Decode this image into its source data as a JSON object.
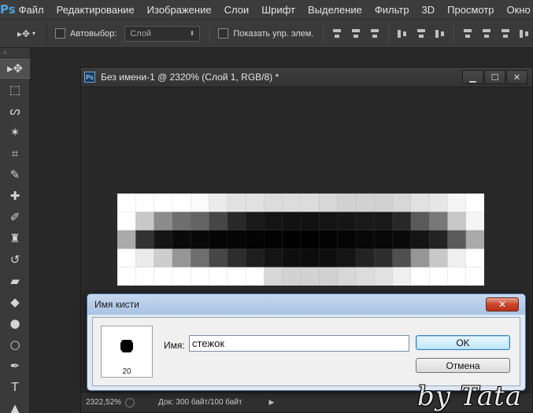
{
  "menubar": {
    "logo": "Ps",
    "items": [
      "Файл",
      "Редактирование",
      "Изображение",
      "Слои",
      "Шрифт",
      "Выделение",
      "Фильтр",
      "3D",
      "Просмотр",
      "Окно"
    ]
  },
  "options": {
    "tool_preset_icon": "move-tool-icon",
    "autoselect_label": "Автовыбор:",
    "autoselect_value": "Слой",
    "show_transform_label": "Показать упр. элем."
  },
  "tools": {
    "header": "»",
    "items": [
      {
        "name": "move-tool-icon",
        "glyph": "▸✥",
        "active": true
      },
      {
        "name": "marquee-tool-icon",
        "glyph": "⬚"
      },
      {
        "name": "lasso-tool-icon",
        "glyph": "ᔕ"
      },
      {
        "name": "magic-wand-tool-icon",
        "glyph": "✶"
      },
      {
        "name": "crop-tool-icon",
        "glyph": "⌗"
      },
      {
        "name": "eyedropper-tool-icon",
        "glyph": "✎"
      },
      {
        "name": "healing-brush-tool-icon",
        "glyph": "✚"
      },
      {
        "name": "brush-tool-icon",
        "glyph": "✐"
      },
      {
        "name": "clone-stamp-tool-icon",
        "glyph": "♜"
      },
      {
        "name": "history-brush-tool-icon",
        "glyph": "↺"
      },
      {
        "name": "eraser-tool-icon",
        "glyph": "▰"
      },
      {
        "name": "paint-bucket-tool-icon",
        "glyph": "◆"
      },
      {
        "name": "blur-tool-icon",
        "glyph": "●"
      },
      {
        "name": "dodge-tool-icon",
        "glyph": "○"
      },
      {
        "name": "pen-tool-icon",
        "glyph": "✒"
      },
      {
        "name": "type-tool-icon",
        "glyph": "T"
      },
      {
        "name": "path-selection-tool-icon",
        "glyph": "▲"
      }
    ]
  },
  "document": {
    "icon": "Ps",
    "title": "Без имени-1 @ 2320% (Слой 1, RGB/8) *",
    "zoom": "2322,52%",
    "doc_info": "Док: 300 байт/100 байт",
    "window_buttons": {
      "minimize": "▁",
      "maximize": "☐",
      "close": "✕"
    },
    "pixels": [
      [
        255,
        255,
        255,
        255,
        250,
        235,
        225,
        225,
        220,
        220,
        220,
        215,
        210,
        210,
        210,
        215,
        225,
        230,
        245,
        255
      ],
      [
        255,
        200,
        140,
        110,
        100,
        70,
        40,
        25,
        20,
        18,
        18,
        20,
        22,
        25,
        25,
        40,
        90,
        120,
        200,
        245
      ],
      [
        170,
        50,
        20,
        10,
        8,
        5,
        5,
        3,
        3,
        2,
        2,
        3,
        4,
        8,
        8,
        10,
        20,
        35,
        90,
        170
      ],
      [
        255,
        235,
        205,
        150,
        110,
        70,
        45,
        30,
        20,
        15,
        12,
        15,
        20,
        35,
        45,
        80,
        150,
        200,
        240,
        255
      ],
      [
        255,
        255,
        255,
        255,
        255,
        255,
        255,
        255,
        215,
        210,
        210,
        210,
        215,
        220,
        225,
        240,
        255,
        255,
        255,
        255
      ]
    ]
  },
  "dialog": {
    "title": "Имя кисти",
    "close_glyph": "✕",
    "brush_size": "20",
    "name_label": "Имя:",
    "name_value": "стежок",
    "ok_label": "OK",
    "cancel_label": "Отмена"
  },
  "watermark": "by Tata"
}
